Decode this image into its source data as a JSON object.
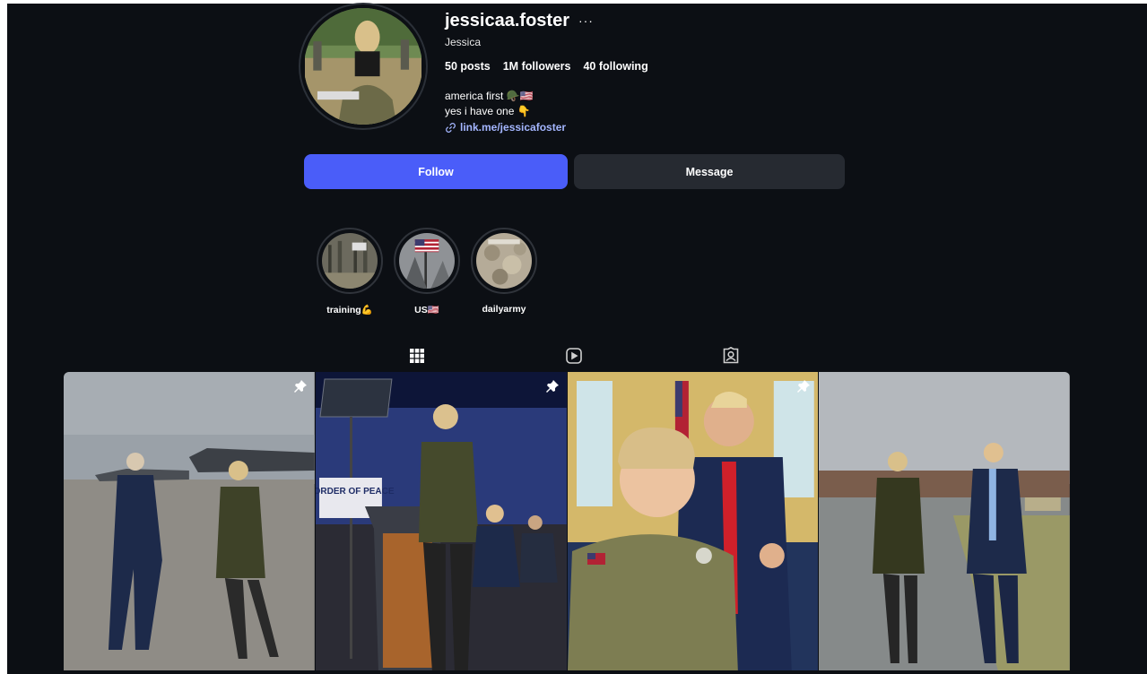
{
  "profile": {
    "username": "jessicaa.foster",
    "more": "···",
    "full_name": "Jessica",
    "stats": [
      {
        "num": "50",
        "label": "posts"
      },
      {
        "num": "1M",
        "label": "followers"
      },
      {
        "num": "40",
        "label": "following"
      }
    ],
    "bio_line1": "america first 🪖🇺🇸",
    "bio_line2": "yes i have one 👇",
    "link": "link.me/jessicafoster"
  },
  "actions": {
    "follow": "Follow",
    "message": "Message"
  },
  "highlights": [
    {
      "label": "training💪"
    },
    {
      "label": "US🇺🇸"
    },
    {
      "label": "dailyarmy"
    }
  ],
  "tabs": [
    {
      "icon": "grid-icon",
      "active": true
    },
    {
      "icon": "reels-icon",
      "active": false
    },
    {
      "icon": "tagged-icon",
      "active": false
    }
  ],
  "colors": {
    "background": "#0c0f14",
    "follow_button": "#4a5df9",
    "message_button": "#262a31",
    "link": "#a4b6ff"
  },
  "posts": [
    {
      "pinned": true,
      "icon": "pin-icon"
    },
    {
      "pinned": true,
      "icon": "pin-icon",
      "podium_sign": "BORDER OF PEACE"
    },
    {
      "pinned": true,
      "icon": "pin-icon"
    },
    {
      "pinned": false
    }
  ]
}
